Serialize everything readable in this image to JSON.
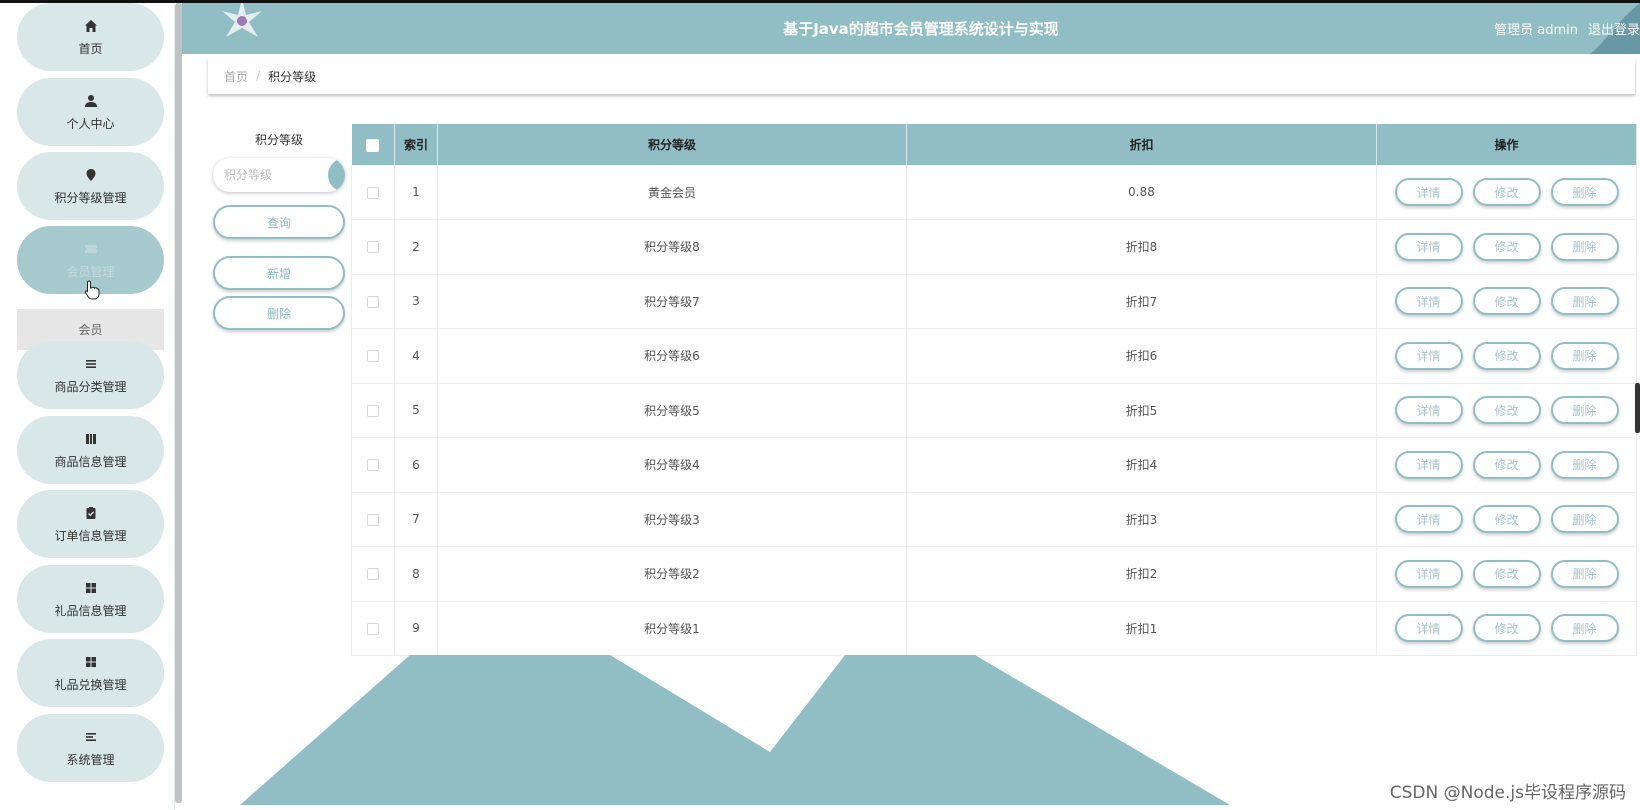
{
  "header": {
    "title": "基于Java的超市会员管理系统设计与实现",
    "user_label": "管理员 admin",
    "logout_label": "退出登录"
  },
  "sidebar": {
    "items": [
      {
        "label": "首页",
        "icon": "home-icon"
      },
      {
        "label": "个人中心",
        "icon": "user-icon"
      },
      {
        "label": "积分等级管理",
        "icon": "location-pin-icon"
      },
      {
        "label": "会员管理",
        "icon": "ticket-icon"
      },
      {
        "label": "商品分类管理",
        "icon": "list-icon"
      },
      {
        "label": "商品信息管理",
        "icon": "book-icon"
      },
      {
        "label": "订单信息管理",
        "icon": "clipboard-check-icon"
      },
      {
        "label": "礼品信息管理",
        "icon": "grid-icon"
      },
      {
        "label": "礼品兑换管理",
        "icon": "grid-icon"
      },
      {
        "label": "系统管理",
        "icon": "menu-icon"
      }
    ],
    "sub_item": "会员"
  },
  "breadcrumb": {
    "home": "首页",
    "separator": "/",
    "current": "积分等级"
  },
  "filter": {
    "label": "积分等级",
    "placeholder": "积分等级",
    "search_label": "查询",
    "add_label": "新增",
    "delete_label": "删除"
  },
  "table": {
    "headers": {
      "index": "索引",
      "level": "积分等级",
      "discount": "折扣",
      "actions": "操作"
    },
    "action_labels": {
      "detail": "详情",
      "edit": "修改",
      "delete": "删除"
    },
    "rows": [
      {
        "index": "1",
        "level": "黄金会员",
        "discount": "0.88"
      },
      {
        "index": "2",
        "level": "积分等级8",
        "discount": "折扣8"
      },
      {
        "index": "3",
        "level": "积分等级7",
        "discount": "折扣7"
      },
      {
        "index": "4",
        "level": "积分等级6",
        "discount": "折扣6"
      },
      {
        "index": "5",
        "level": "积分等级5",
        "discount": "折扣5"
      },
      {
        "index": "6",
        "level": "积分等级4",
        "discount": "折扣4"
      },
      {
        "index": "7",
        "level": "积分等级3",
        "discount": "折扣3"
      },
      {
        "index": "8",
        "level": "积分等级2",
        "discount": "折扣2"
      },
      {
        "index": "9",
        "level": "积分等级1",
        "discount": "折扣1"
      }
    ]
  },
  "watermark": "CSDN @Node.js毕设程序源码",
  "colors": {
    "accent": "#91bec5",
    "menu_bg": "#d9e7e8",
    "menu_active": "#a6c9ce"
  }
}
